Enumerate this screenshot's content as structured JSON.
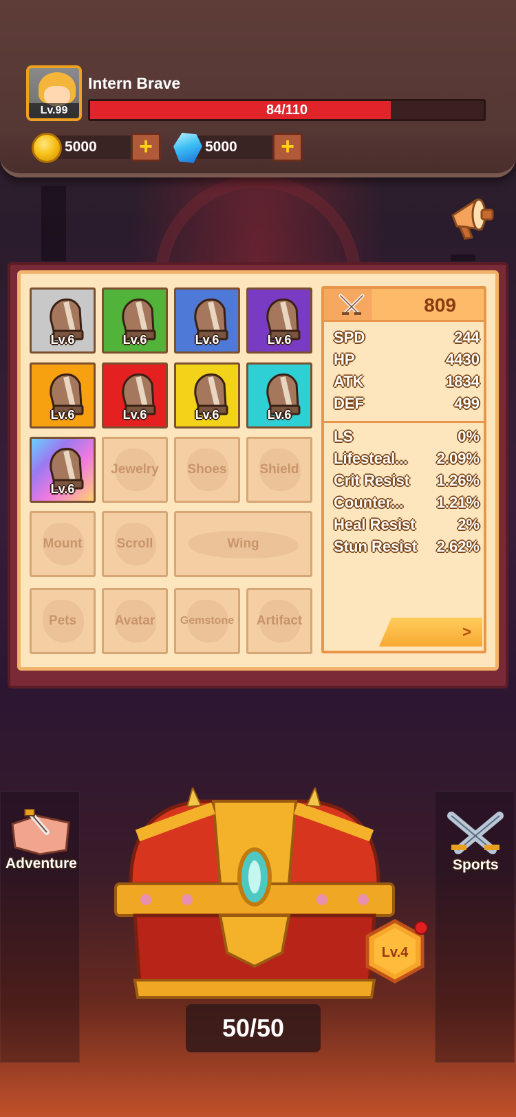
{
  "player": {
    "name": "Intern Brave",
    "level_label": "Lv.99",
    "hp_text": "84/110",
    "hp_fraction": 0.7636
  },
  "currencies": {
    "gold": "5000",
    "gems": "5000"
  },
  "equipment": {
    "slots": [
      {
        "level": "Lv.6",
        "rarity_color": "#c8c8c8"
      },
      {
        "level": "Lv.6",
        "rarity_color": "#52b33a"
      },
      {
        "level": "Lv.6",
        "rarity_color": "#4f79d6"
      },
      {
        "level": "Lv.6",
        "rarity_color": "#7a3bc4"
      },
      {
        "level": "Lv.6",
        "rarity_color": "#f7a010"
      },
      {
        "level": "Lv.6",
        "rarity_color": "#e42020"
      },
      {
        "level": "Lv.6",
        "rarity_color": "#f3d21a"
      },
      {
        "level": "Lv.6",
        "rarity_color": "#2ed0d6"
      },
      {
        "level": "Lv.6",
        "rarity_color": "rainbow"
      }
    ],
    "empty_slots": [
      "Jewelry",
      "Shoes",
      "Shield",
      "Mount",
      "Scroll",
      "Wing",
      "Pets",
      "Avatar",
      "Gemstone",
      "Artifact"
    ]
  },
  "stats": {
    "power": "809",
    "primary": [
      {
        "label": "SPD",
        "value": "244"
      },
      {
        "label": "HP",
        "value": "4430"
      },
      {
        "label": "ATK",
        "value": "1834"
      },
      {
        "label": "DEF",
        "value": "499"
      }
    ],
    "secondary": [
      {
        "label": "LS",
        "value": "0%"
      },
      {
        "label": "Lifesteal...",
        "value": "2.09%"
      },
      {
        "label": "Crit Resist",
        "value": "1.26%"
      },
      {
        "label": "Counter...",
        "value": "1.21%"
      },
      {
        "label": "Heal Resist",
        "value": "2%"
      },
      {
        "label": "Stun Resist",
        "value": "2.62%"
      }
    ],
    "more_arrow": ">"
  },
  "nav": {
    "adventure": "Adventure",
    "sports": "Sports"
  },
  "chest": {
    "level": "Lv.4",
    "count": "50/50"
  },
  "icons": [
    "gold-coin-icon",
    "gem-icon",
    "plus-icon",
    "megaphone-icon",
    "crossed-swords-icon",
    "gauntlet-icon",
    "adventure-map-icon",
    "sports-swords-icon",
    "treasure-chest-icon"
  ]
}
